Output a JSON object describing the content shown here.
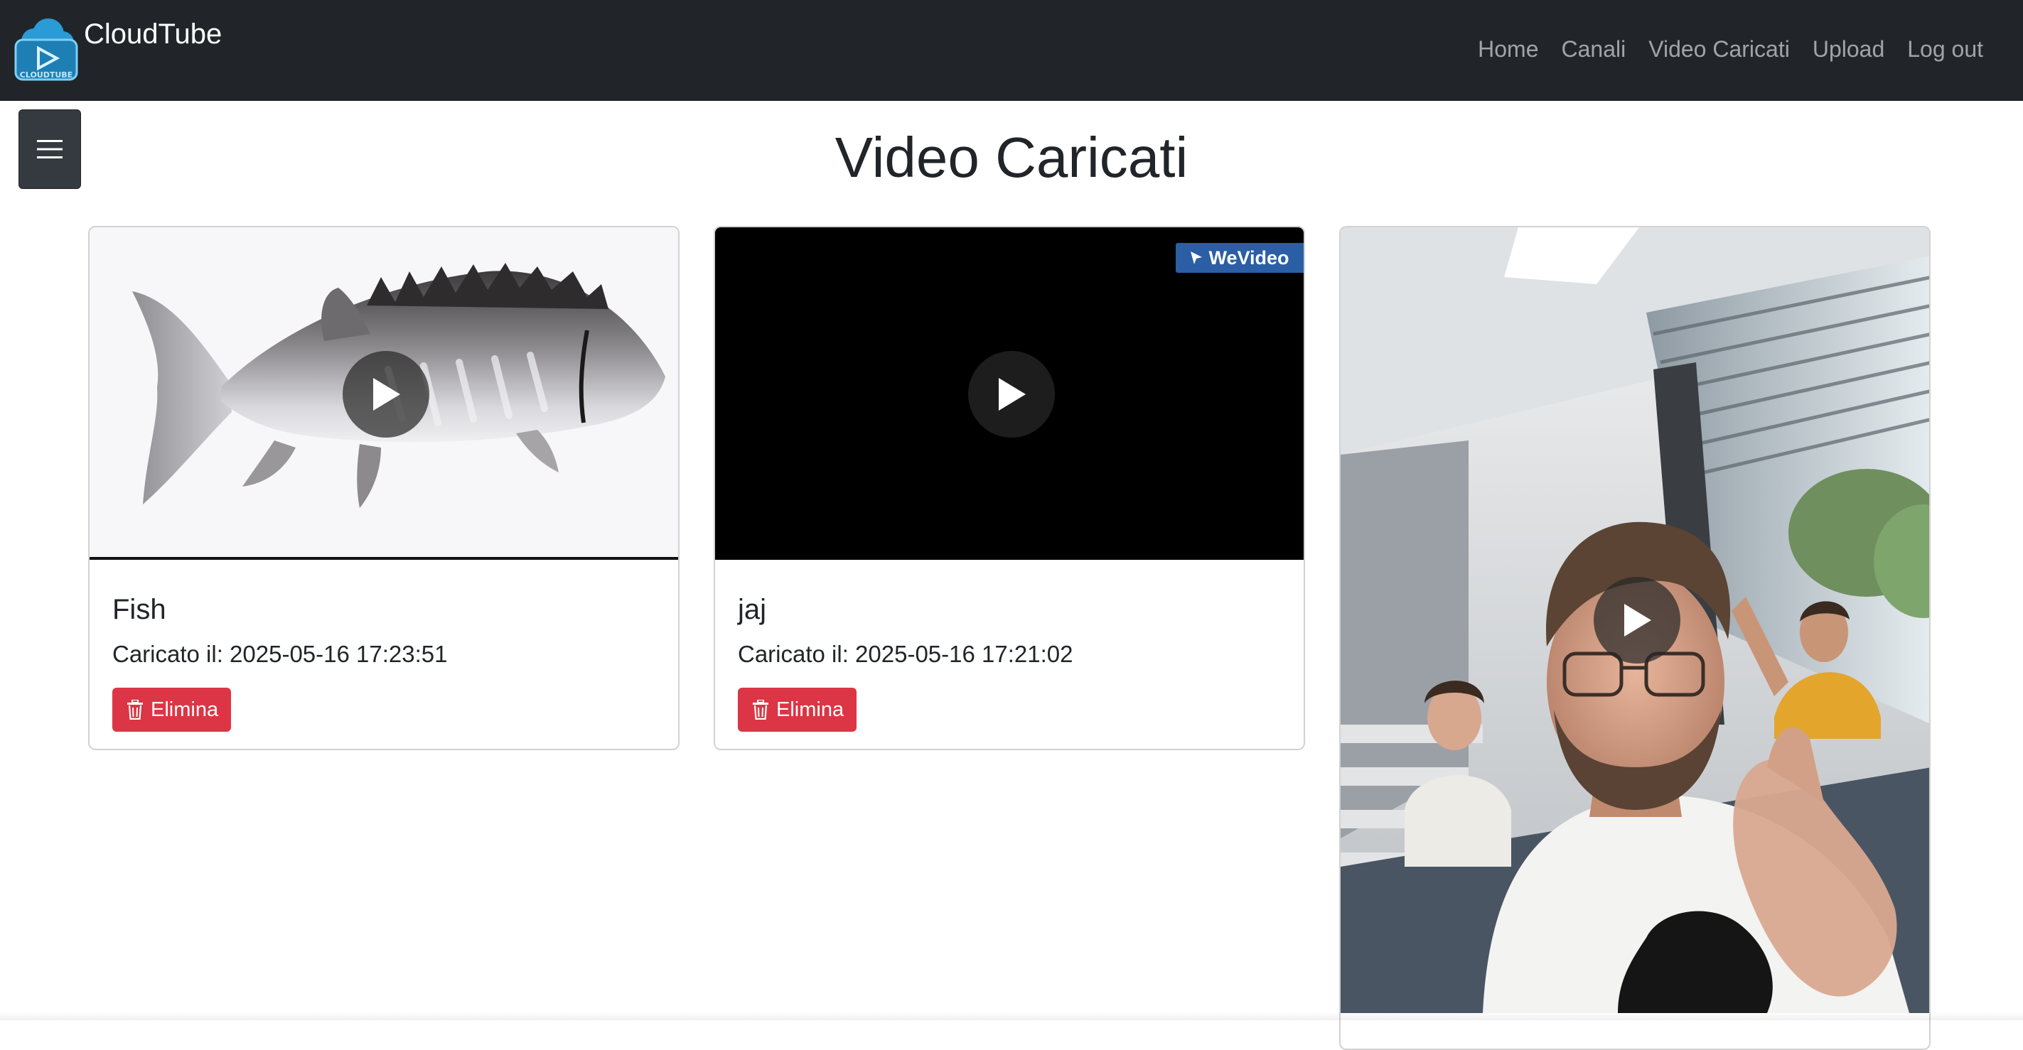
{
  "navbar": {
    "brand": "CloudTube",
    "logo_text": "CLOUDTUBE",
    "links": [
      "Home",
      "Canali",
      "Video Caricati",
      "Upload",
      "Log out"
    ]
  },
  "menu_toggle_icon": "hamburger-icon",
  "page": {
    "title": "Video Caricati"
  },
  "videos": [
    {
      "title": "Fish",
      "uploaded": "Caricato il: 2025-05-16 17:23:51",
      "delete_label": "Elimina",
      "thumbnail": "fish"
    },
    {
      "title": "jaj",
      "uploaded": "Caricato il: 2025-05-16 17:21:02",
      "delete_label": "Elimina",
      "thumbnail": "black-frame",
      "watermark": "WeVideo"
    },
    {
      "thumbnail": "classroom-selfie"
    }
  ],
  "colors": {
    "navbar_bg": "#212529",
    "danger": "#dc3545",
    "watermark_bg": "#2b5ea4"
  }
}
